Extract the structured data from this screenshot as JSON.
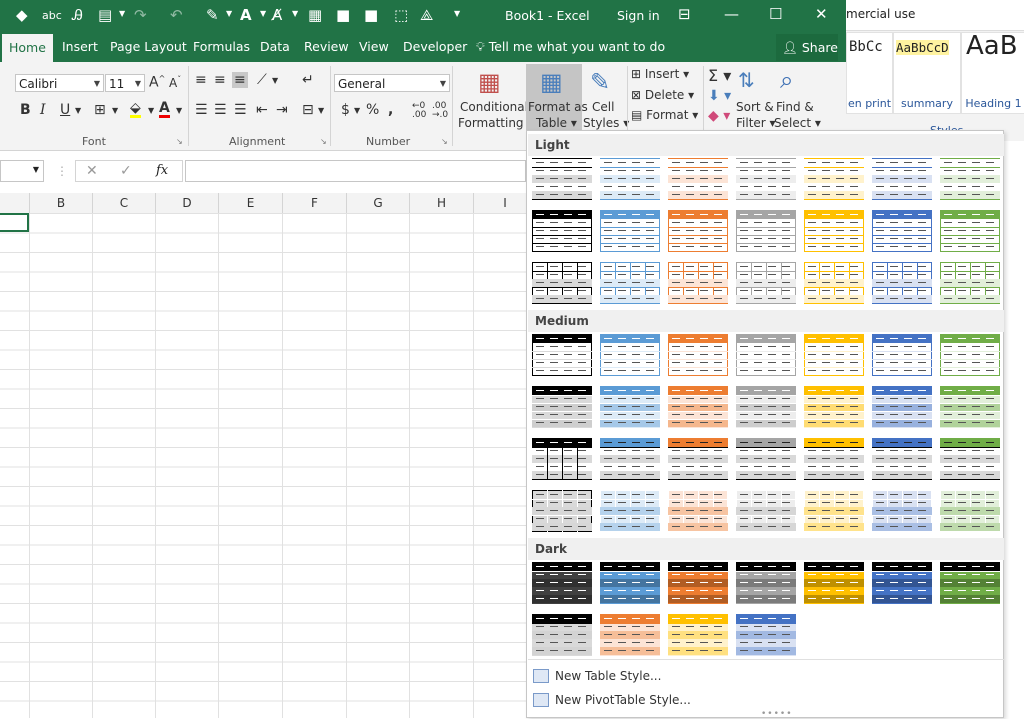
{
  "background_window": {
    "title_fragment": "mercial use",
    "styles": [
      {
        "sample": "BbCc",
        "name": "en print"
      },
      {
        "sample": "AaBbCcD",
        "name": "summary"
      },
      {
        "sample": "AaB",
        "name": "Heading 1"
      }
    ],
    "group_label": "Styles"
  },
  "titlebar": {
    "title": "Book1 - Excel",
    "signin": "Sign in"
  },
  "tabs": [
    "Home",
    "Insert",
    "Page Layout",
    "Formulas",
    "Data",
    "Review",
    "View",
    "Developer"
  ],
  "tellme": "Tell me what you want to do",
  "share": "Share",
  "ribbon": {
    "font_name": "Calibri",
    "font_size": "11",
    "number_format": "General",
    "groups": {
      "font": "Font",
      "alignment": "Alignment",
      "number": "Number"
    },
    "conditional_formatting": [
      "Conditional",
      "Formatting"
    ],
    "format_as_table": [
      "Format as",
      "Table"
    ],
    "cell_styles": [
      "Cell",
      "Styles"
    ],
    "cells": [
      "Insert",
      "Delete",
      "Format"
    ],
    "sort_filter": [
      "Sort &",
      "Filter"
    ],
    "find_select": [
      "Find &",
      "Select"
    ]
  },
  "formula_bar": {
    "fx": "fx"
  },
  "columns": [
    "B",
    "C",
    "D",
    "E",
    "F",
    "G",
    "H",
    "I"
  ],
  "gallery": {
    "sections": [
      "Light",
      "Medium",
      "Dark"
    ],
    "commands": [
      "New Table Style...",
      "New PivotTable Style..."
    ],
    "colors": [
      "#000000",
      "#5b9bd5",
      "#ed7d31",
      "#a5a5a5",
      "#ffc000",
      "#4472c4",
      "#70ad47"
    ],
    "light_tints": [
      "#d9d9d9",
      "#ddebf7",
      "#fce4d6",
      "#ededed",
      "#fff2cc",
      "#d9e1f2",
      "#e2efda"
    ]
  }
}
